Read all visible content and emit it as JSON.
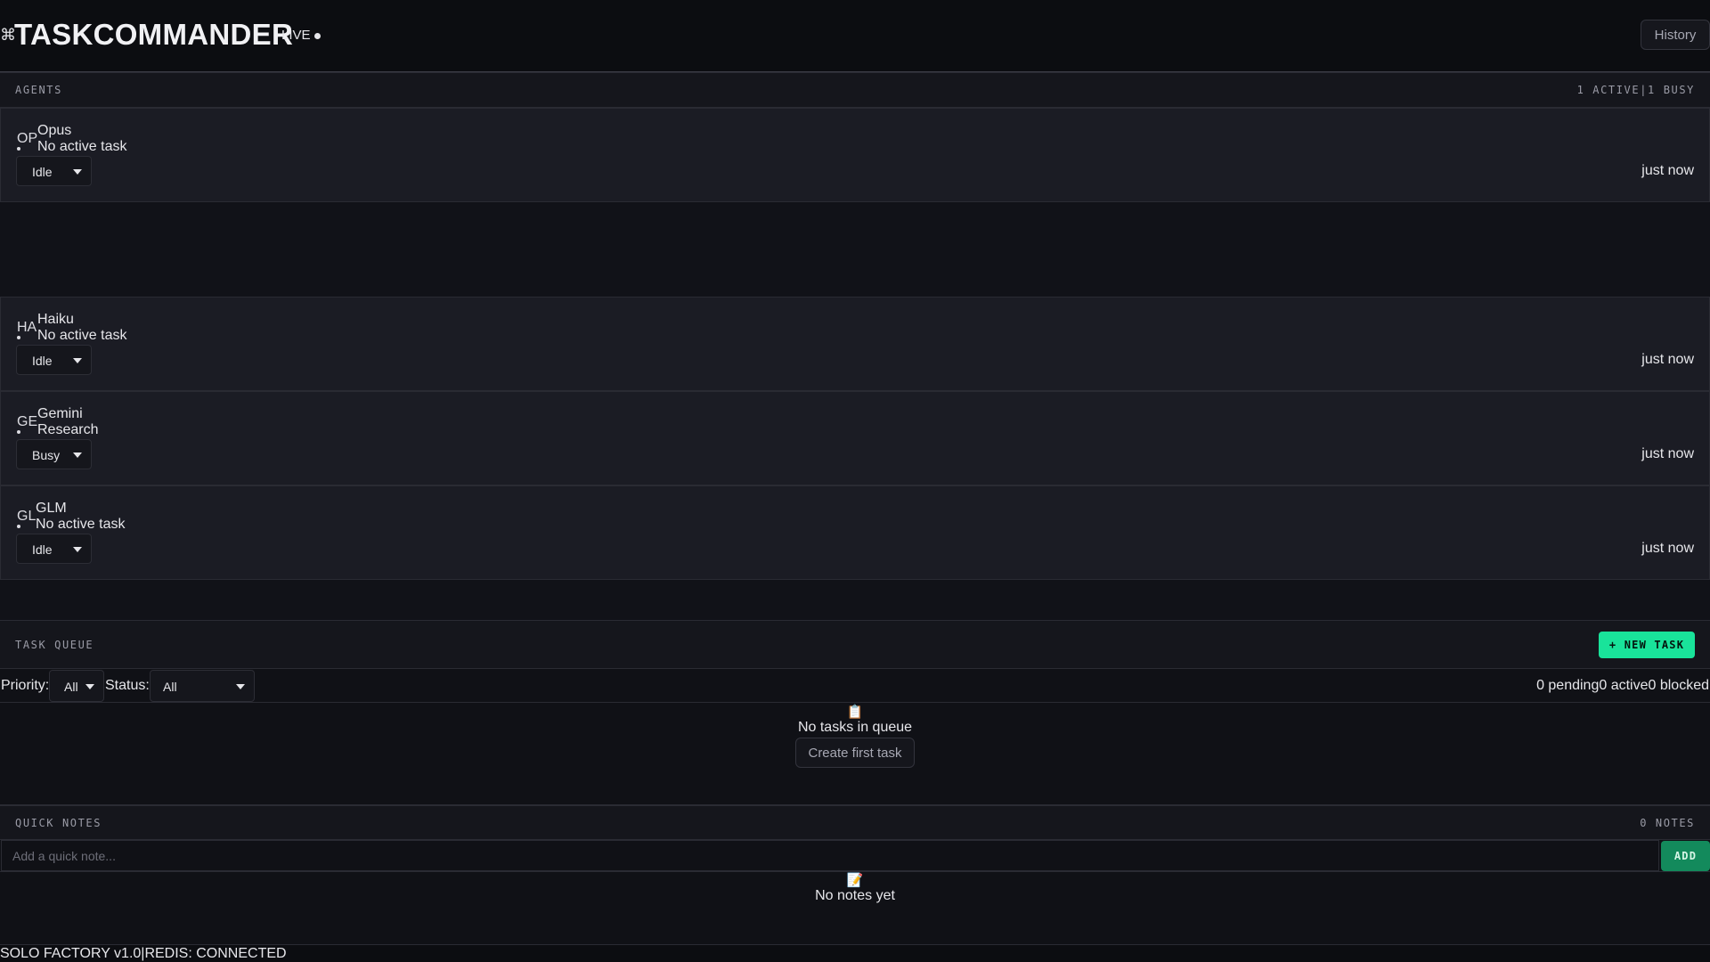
{
  "header": {
    "logo_symbol": "⌘",
    "title": "TASKCOMMANDER",
    "live_label": "LIVE",
    "history_label": "History"
  },
  "agents_section": {
    "title": "AGENTS",
    "active_count": "1 ACTIVE",
    "separator": "|",
    "busy_count": "1 BUSY",
    "agents": [
      {
        "abbr": "OP",
        "name": "Opus",
        "task": "No active task",
        "status": "Idle",
        "last_seen": "just now"
      },
      {
        "abbr": "HA",
        "name": "Haiku",
        "task": "No active task",
        "status": "Idle",
        "last_seen": "just now"
      },
      {
        "abbr": "GE",
        "name": "Gemini",
        "task": "Research",
        "status": "Busy",
        "last_seen": "just now"
      },
      {
        "abbr": "GL",
        "name": "GLM",
        "task": "No active task",
        "status": "Idle",
        "last_seen": "just now"
      }
    ]
  },
  "task_queue": {
    "title": "TASK QUEUE",
    "new_task_label": "+ NEW TASK",
    "priority_label": "Priority:",
    "priority_value": "All",
    "status_label": "Status:",
    "status_value": "All",
    "pending": "0 pending",
    "active": "0 active",
    "blocked": "0 blocked",
    "empty_icon": "📋",
    "empty_text": "No tasks in queue",
    "create_first_label": "Create first task"
  },
  "quick_notes": {
    "title": "QUICK NOTES",
    "count": "0 NOTES",
    "input_placeholder": "Add a quick note...",
    "add_label": "ADD",
    "empty_icon": "📝",
    "empty_text": "No notes yet"
  },
  "footer": {
    "version": "SOLO FACTORY v1.0",
    "separator": "|",
    "redis_status": "REDIS: CONNECTED"
  },
  "colors": {
    "accent": "#19e39a",
    "add_button": "#138a5c",
    "background": "#111218",
    "card": "#1b1c24"
  }
}
